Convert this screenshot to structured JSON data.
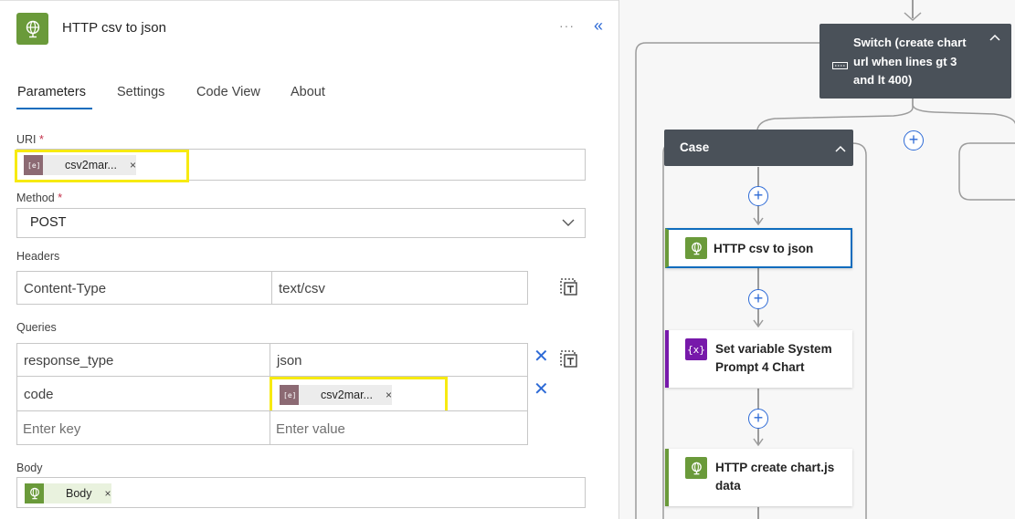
{
  "panel": {
    "title": "HTTP csv to json",
    "more_label": "···",
    "collapse_label": "«",
    "tabs": [
      {
        "label": "Parameters"
      },
      {
        "label": "Settings"
      },
      {
        "label": "Code View"
      },
      {
        "label": "About"
      }
    ],
    "uri": {
      "label": "URI",
      "required": "*",
      "token": "csv2mar...",
      "token_close": "×"
    },
    "method": {
      "label": "Method",
      "required": "*",
      "value": "POST"
    },
    "headers": {
      "label": "Headers",
      "rows": [
        {
          "key": "Content-Type",
          "value": "text/csv"
        }
      ]
    },
    "queries": {
      "label": "Queries",
      "row1": {
        "key": "response_type",
        "value": "json"
      },
      "row2": {
        "key": "code",
        "token": "csv2mar...",
        "token_close": "×"
      },
      "key_placeholder": "Enter key",
      "value_placeholder": "Enter value",
      "delete_glyph": "✕"
    },
    "body": {
      "label": "Body",
      "token": "Body",
      "token_close": "×"
    }
  },
  "canvas": {
    "switch_node": {
      "title": "Switch (create chart url when lines gt 3 and lt 400)",
      "chevron": "^"
    },
    "case_node": {
      "title": "Case",
      "chevron": "^"
    },
    "nodes": [
      {
        "title": "HTTP csv to json",
        "kind": "http"
      },
      {
        "title": "Set variable System Prompt 4 Chart",
        "kind": "variable"
      },
      {
        "title": "HTTP create chart.js data",
        "kind": "http"
      }
    ],
    "plus_glyph": "+",
    "colors": {
      "http": "#6a9a3a",
      "variable": "#7719aa",
      "selected": "#0f6cbd",
      "highlight": "#f7ea11"
    }
  }
}
